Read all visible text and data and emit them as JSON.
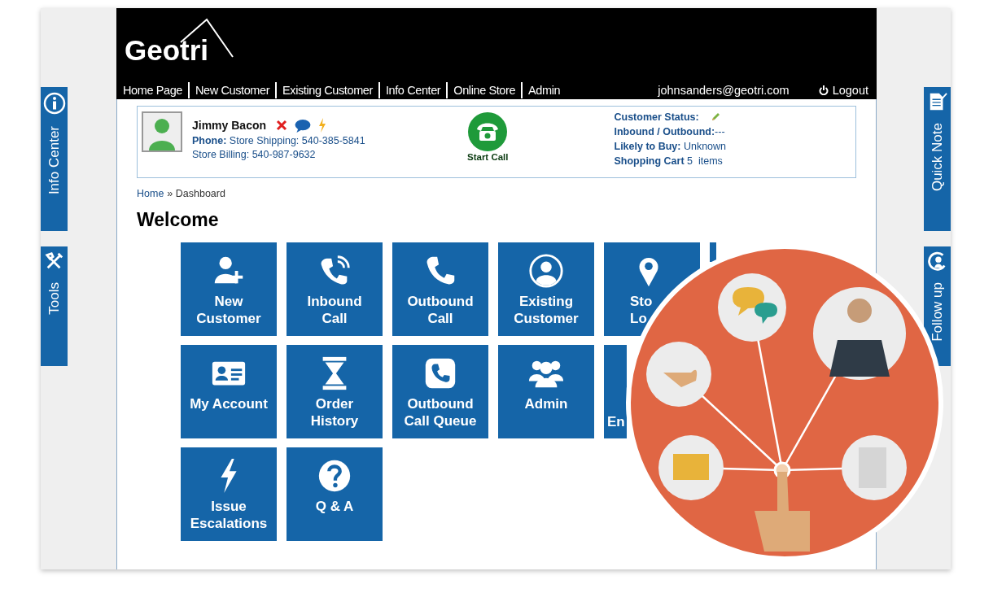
{
  "logo": "Geotri",
  "nav": [
    "Home Page",
    "New Customer",
    "Existing Customer",
    "Info Center",
    "Online Store",
    "Admin"
  ],
  "user_email": "johnsanders@geotri.com",
  "logout": "Logout",
  "left_tabs": [
    {
      "label": "Info Center",
      "kind": "info"
    },
    {
      "label": "Tools",
      "kind": "tools"
    }
  ],
  "right_tabs": [
    {
      "label": "Quick Note",
      "kind": "note"
    },
    {
      "label": "Follow up",
      "kind": "followup"
    }
  ],
  "customer": {
    "name": "Jimmy Bacon",
    "phone_label": "Phone:",
    "phone": "Store Shipping: 540-385-5841",
    "billing": "Store Billing: 540-987-9632",
    "call_button": "Start Call",
    "status": [
      {
        "label": "Customer Status:",
        "kind": "edit"
      },
      {
        "label": "Inbound / Outbound:",
        "value": "---",
        "kind": "text"
      },
      {
        "label": "Likely to Buy:",
        "value": "Unknown",
        "kind": "text"
      },
      {
        "label": "Shopping Cart",
        "value": "5  items",
        "kind": "text"
      }
    ]
  },
  "breadcrumb": {
    "link": "Home",
    "separator": "»",
    "current": "Dashboard"
  },
  "heading": "Welcome",
  "tiles": [
    {
      "kind": "full",
      "lines": [
        "New",
        "Customer"
      ]
    },
    {
      "kind": "full",
      "lines": [
        "Inbound",
        "Call"
      ]
    },
    {
      "kind": "full",
      "lines": [
        "Outbound",
        "Call"
      ]
    },
    {
      "kind": "full",
      "lines": [
        "Existing",
        "Customer"
      ]
    },
    {
      "kind": "cut",
      "lines": [
        "Sto",
        "Lo"
      ]
    },
    {
      "kind": "hidden"
    },
    {
      "kind": "full",
      "lines": [
        "My Account"
      ]
    },
    {
      "kind": "full",
      "lines": [
        "Order",
        "History"
      ]
    },
    {
      "kind": "full",
      "lines": [
        "Outbound",
        "Call Queue"
      ]
    },
    {
      "kind": "full",
      "lines": [
        "Admin"
      ]
    },
    {
      "kind": "cut",
      "lines": [
        "En"
      ]
    },
    {
      "kind": "full",
      "lines": [
        "Issue",
        "Escalations"
      ]
    },
    {
      "kind": "full",
      "lines": [
        "Q & A"
      ]
    }
  ]
}
